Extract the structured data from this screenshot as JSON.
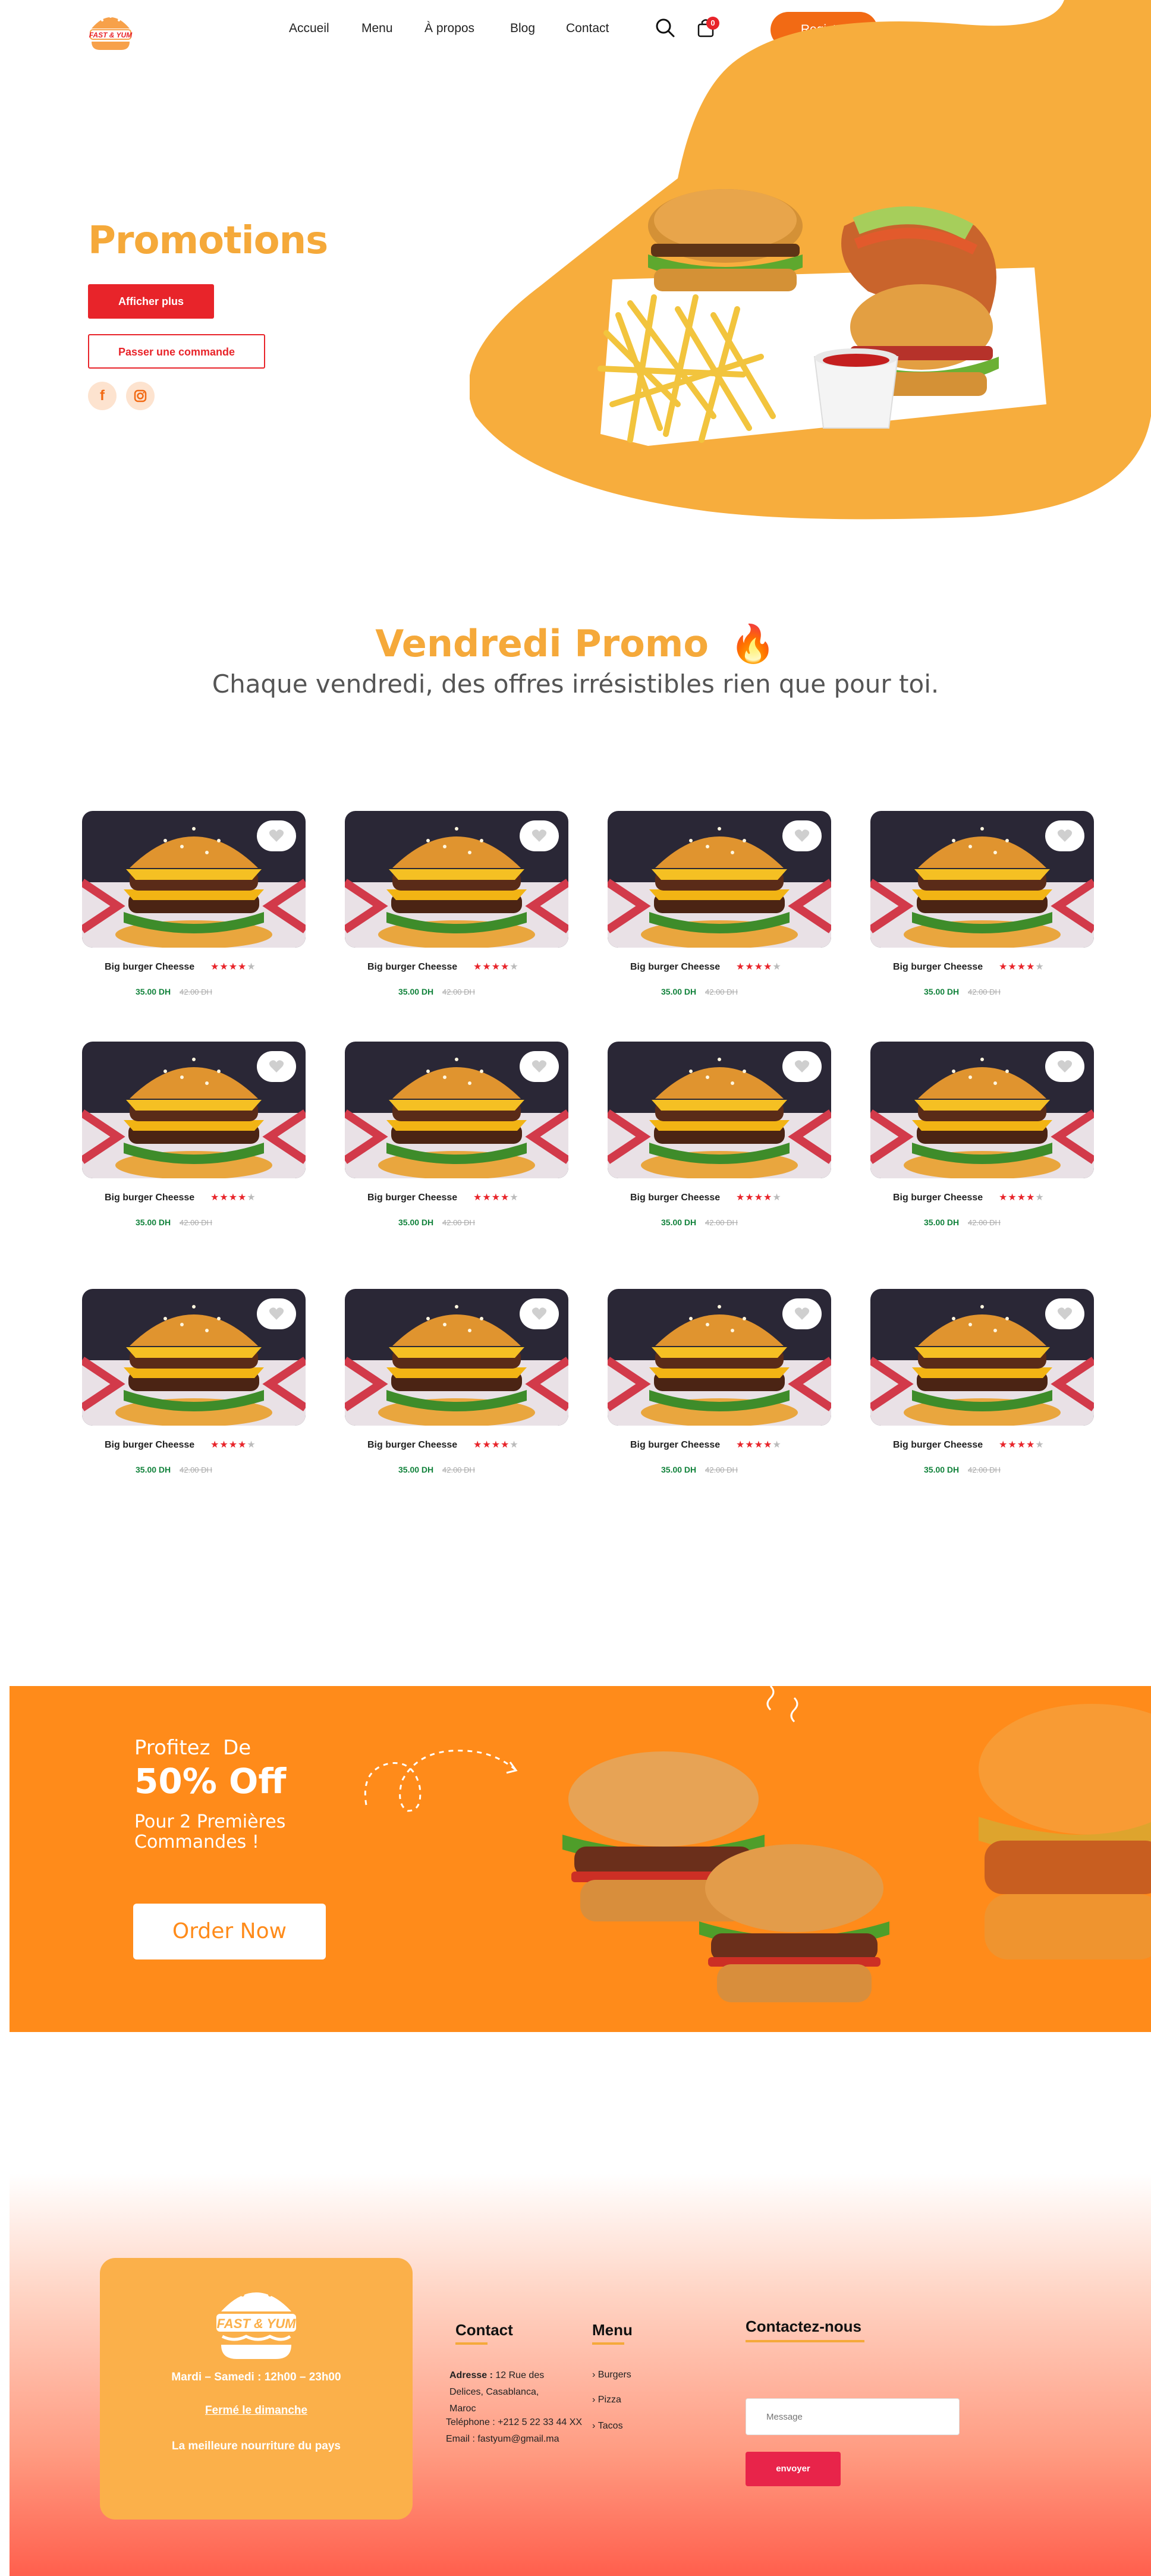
{
  "nav": {
    "brand": "FAST & YUM",
    "links": [
      "Accueil",
      "Menu",
      "À propos",
      "Blog",
      "Contact"
    ],
    "cart_count": "0",
    "register": "Register"
  },
  "hero": {
    "title": "Promotions",
    "primary_btn": "Afficher plus",
    "secondary_btn": "Passer une commande",
    "social": [
      "facebook-icon",
      "instagram-icon"
    ]
  },
  "promo": {
    "title": "Vendredi Promo",
    "emoji": "🔥",
    "subtitle": "Chaque vendredi, des offres irrésistibles rien que pour toi."
  },
  "products": [
    {
      "name": "Big burger Cheesse",
      "rating": 4,
      "price": "35.00 DH",
      "old_price": "42.00 DH"
    },
    {
      "name": "Big burger Cheesse",
      "rating": 4,
      "price": "35.00 DH",
      "old_price": "42.00 DH"
    },
    {
      "name": "Big burger Cheesse",
      "rating": 4,
      "price": "35.00 DH",
      "old_price": "42.00 DH"
    },
    {
      "name": "Big burger Cheesse",
      "rating": 4,
      "price": "35.00 DH",
      "old_price": "42.00 DH"
    },
    {
      "name": "Big burger Cheesse",
      "rating": 4,
      "price": "35.00 DH",
      "old_price": "42.00 DH"
    },
    {
      "name": "Big burger Cheesse",
      "rating": 4,
      "price": "35.00 DH",
      "old_price": "42.00 DH"
    },
    {
      "name": "Big burger Cheesse",
      "rating": 4,
      "price": "35.00 DH",
      "old_price": "42.00 DH"
    },
    {
      "name": "Big burger Cheesse",
      "rating": 4,
      "price": "35.00 DH",
      "old_price": "42.00 DH"
    },
    {
      "name": "Big burger Cheesse",
      "rating": 4,
      "price": "35.00 DH",
      "old_price": "42.00 DH"
    },
    {
      "name": "Big burger Cheesse",
      "rating": 4,
      "price": "35.00 DH",
      "old_price": "42.00 DH"
    },
    {
      "name": "Big burger Cheesse",
      "rating": 4,
      "price": "35.00 DH",
      "old_price": "42.00 DH"
    },
    {
      "name": "Big burger Cheesse",
      "rating": 4,
      "price": "35.00 DH",
      "old_price": "42.00 DH"
    }
  ],
  "banner": {
    "line1": "Profitez  De",
    "line2": "50% Off",
    "line3": "Pour 2 Premières Commandes !",
    "cta": "Order Now"
  },
  "footer": {
    "brand": "FAST & YUM",
    "hours": "Mardi – Samedi : 12h00 – 23h00",
    "closed": "Fermé le dimanche",
    "tagline": "La meilleure nourriture du pays",
    "contact_title": "Contact",
    "address_label": "Adresse :",
    "address_line1": "12 Rue des",
    "address_line2": "Delices, Casablanca,",
    "address_line3": "Maroc",
    "phone": "Teléphone : +212 5 22 33 44 XX",
    "email": "Email : fastyum@gmail.ma",
    "menu_title": "Menu",
    "menu_items": [
      "Burgers",
      "Pizza",
      "Tacos"
    ],
    "contact_us_title": "Contactez-nous",
    "message_placeholder": "Message",
    "send": "envoyer"
  },
  "colors": {
    "accent": "#f5a93a",
    "orange": "#ff8b1a",
    "red": "#e8242a",
    "green_price": "#11823b"
  }
}
